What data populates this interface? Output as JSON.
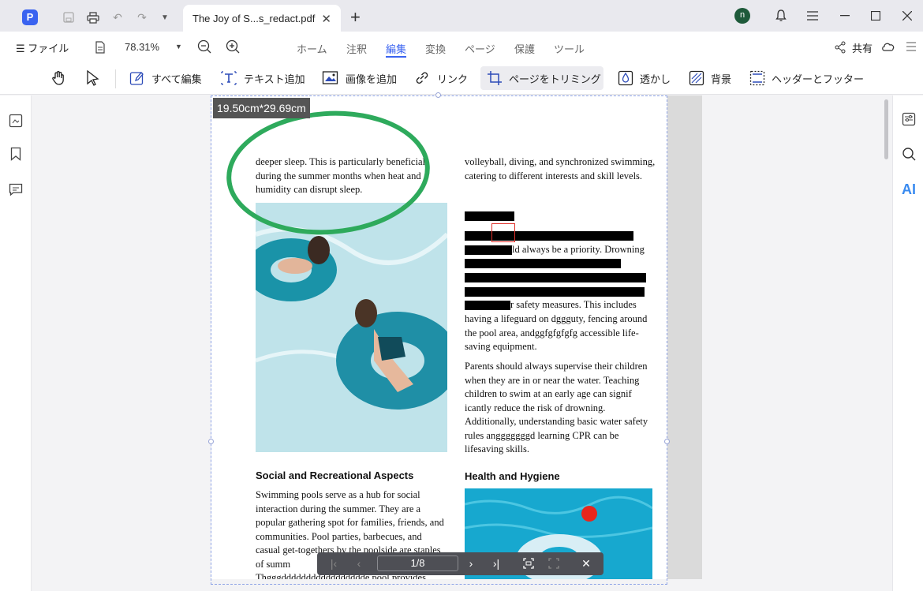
{
  "titlebar": {
    "tab_title": "The Joy of S...s_redact.pdf",
    "user_initial": "n"
  },
  "menubar": {
    "file_label": "ファイル",
    "zoom": "78.31%",
    "tabs": [
      {
        "label": "ホーム"
      },
      {
        "label": "注釈"
      },
      {
        "label": "編集"
      },
      {
        "label": "変換"
      },
      {
        "label": "ページ"
      },
      {
        "label": "保護"
      },
      {
        "label": "ツール"
      }
    ],
    "active_tab": "編集",
    "share_label": "共有"
  },
  "toolbar": {
    "edit_all": "すべて編集",
    "add_text": "テキスト追加",
    "add_image": "画像を追加",
    "link": "リンク",
    "crop_page": "ページをトリミング",
    "watermark": "透かし",
    "background": "背景",
    "header_footer": "ヘッダーとフッター"
  },
  "crop": {
    "size_label": "19.50cm*29.69cm"
  },
  "document": {
    "left_para1": "deeper sleep. This is particularly beneficial during the summer months when heat and humidity can disrupt sleep.",
    "left_heading": "Social and Recreational Aspects",
    "left_para2": "Swimming pools serve as a hub for social interaction during the summer. They are a popular gathering spot for families, friends, and communities. Pool parties, barbecues, and casual get-togethers by the poolside are staples of summ",
    "left_para2_tail": "Thgggddddddddddddddddde pool provides",
    "right_para1": "volleyball, diving, and synchronized swimming, catering to different interests and skill levels.",
    "right_r1": "ld always be a priority. Drowning",
    "right_r2": "r safety measures. This includes",
    "right_para2_rest": "having a lifeguard on dggguty, fencing around the pool area, andggfgfgfgfg accessible life-saving equipment.",
    "right_para3": "Parents should always supervise their children when they are in or near the water. Teaching children to swim at an early age can signif icantly reduce the risk of drowning. Additionally, understanding basic water safety rules angggggggd learning CPR can be lifesaving skills.",
    "right_heading": "Health and Hygiene"
  },
  "navbar": {
    "page_indicator": "1/8"
  },
  "colors": {
    "accent": "#3a63f0",
    "annotation_green": "#2eaa5c",
    "redaction": "#000000"
  }
}
